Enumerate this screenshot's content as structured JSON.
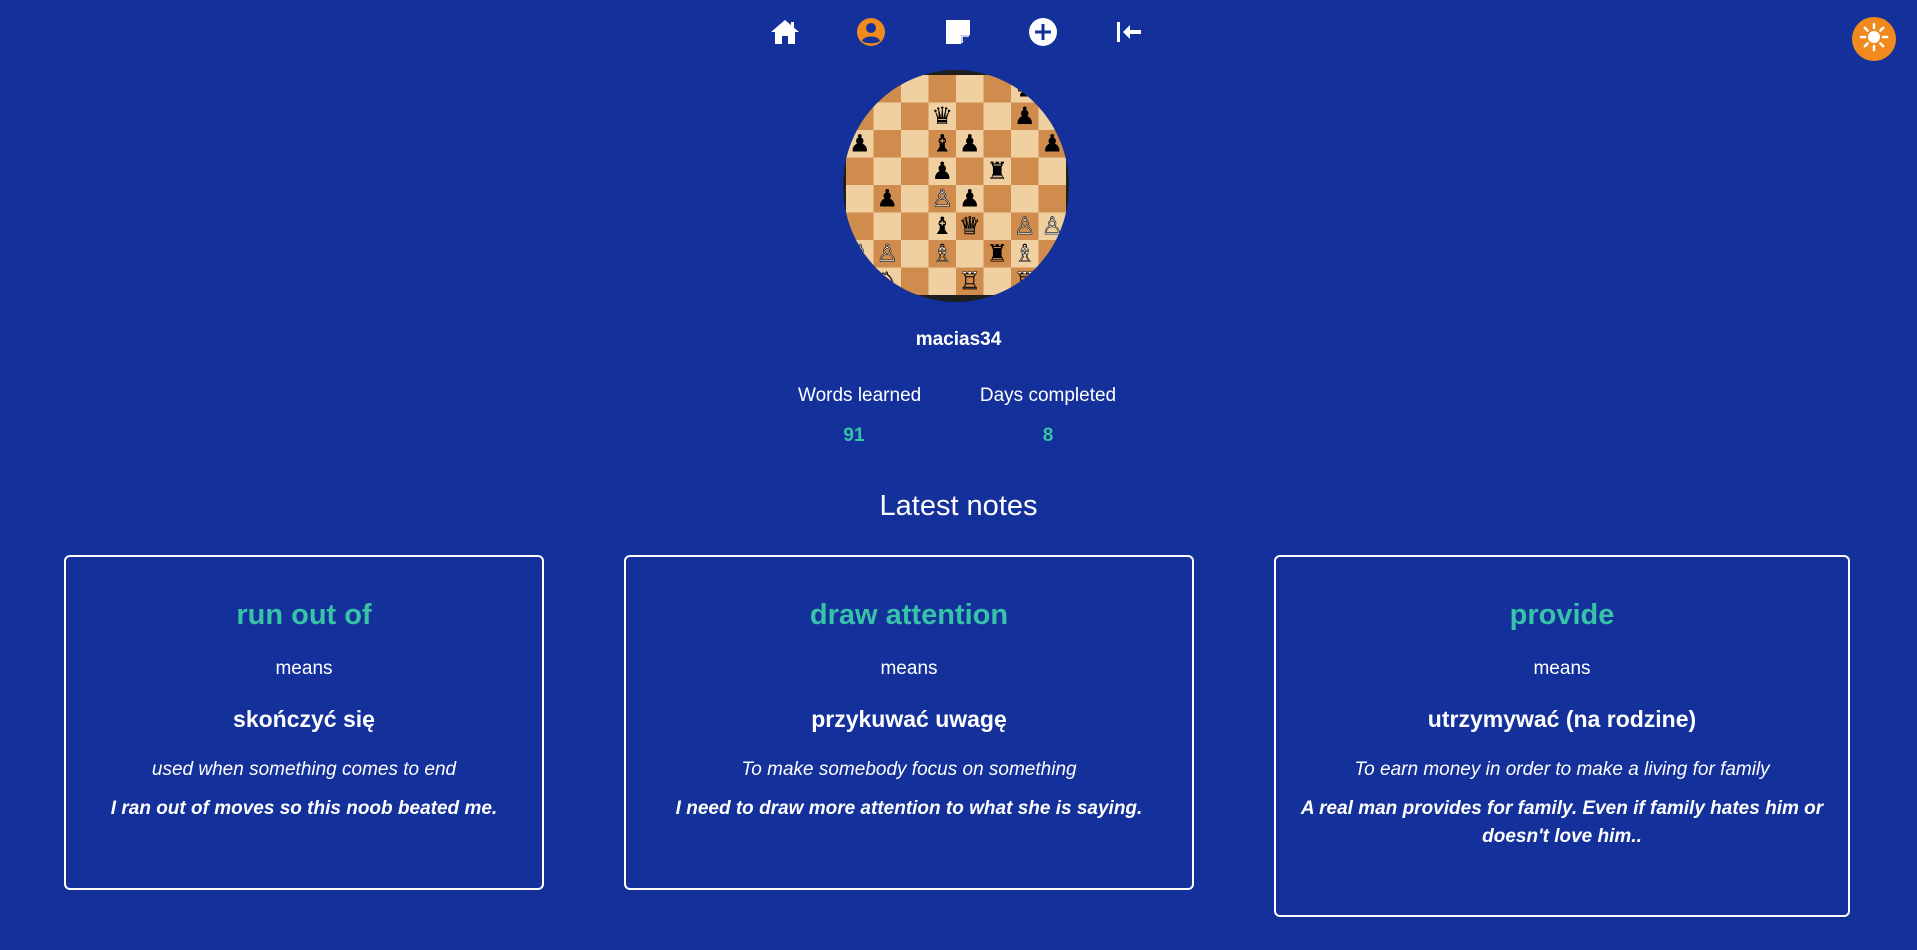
{
  "nav": {
    "items": [
      {
        "name": "home",
        "icon": "home-icon"
      },
      {
        "name": "profile",
        "icon": "user-circle-icon",
        "active": true
      },
      {
        "name": "notes",
        "icon": "note-icon"
      },
      {
        "name": "add",
        "icon": "plus-circle-icon"
      },
      {
        "name": "logout",
        "icon": "arrow-left-to-bar-icon"
      }
    ],
    "active_color": "#f08a1c",
    "theme_toggle_icon": "sun-icon"
  },
  "profile": {
    "avatar_icon": "chess-board-avatar",
    "username": "macias34",
    "stats": [
      {
        "label": "Words learned",
        "value": "91"
      },
      {
        "label": "Days completed",
        "value": "8"
      }
    ]
  },
  "latest_notes": {
    "title": "Latest notes",
    "notes": [
      {
        "word": "run out of",
        "means": "means",
        "translation": "skończyć się",
        "definition": "used when something comes to end",
        "example": "I ran out of moves so this noob beated me."
      },
      {
        "word": "draw attention",
        "means": "means",
        "translation": "przykuwać uwagę",
        "definition": "To make somebody focus on something",
        "example": "I need to draw more attention to what she is saying."
      },
      {
        "word": "provide",
        "means": "means",
        "translation": "utrzymywać (na rodzine)",
        "definition": "To earn money in order to make a living for family",
        "example": "A real man provides for family. Even if family hates him or doesn't love him.."
      }
    ]
  },
  "colors": {
    "background": "#14309a",
    "accent": "#36c3a8",
    "orange": "#f08a1c"
  }
}
